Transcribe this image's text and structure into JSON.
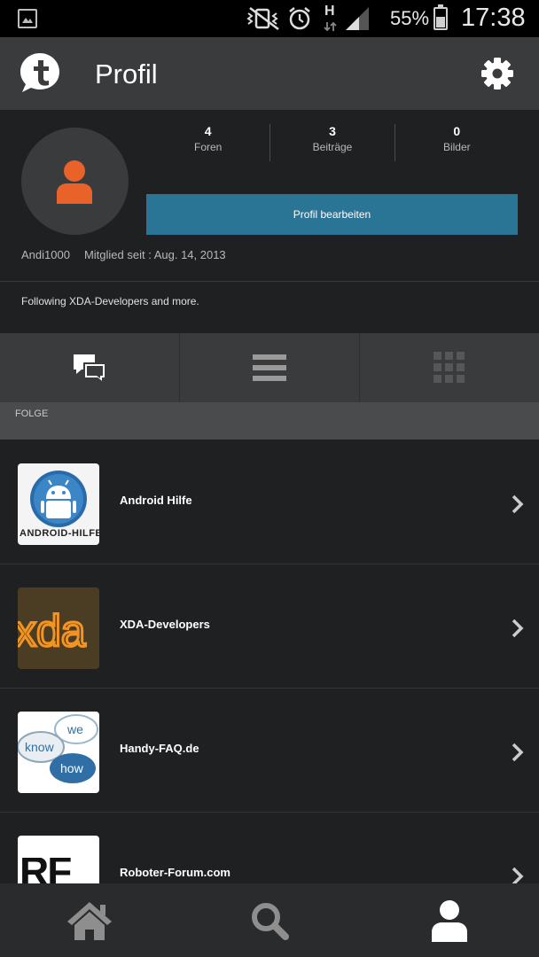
{
  "status_bar": {
    "battery_percent": "55%",
    "time": "17:38",
    "network_label": "H",
    "icons": [
      "gallery-icon",
      "vibrate-mute-icon",
      "alarm-icon",
      "network-h-icon",
      "signal-icon",
      "battery-icon"
    ]
  },
  "app_bar": {
    "title": "Profil",
    "logo_icon": "tapatalk-logo-icon",
    "settings_icon": "gear-icon"
  },
  "profile": {
    "stats": [
      {
        "value": "4",
        "label": "Foren"
      },
      {
        "value": "3",
        "label": "Beiträge"
      },
      {
        "value": "0",
        "label": "Bilder"
      }
    ],
    "edit_button": "Profil bearbeiten",
    "username": "Andi1000",
    "member_since": "Mitglied seit : Aug. 14, 2013",
    "bio": "Following XDA-Developers and more."
  },
  "tabs": [
    "chat-bubbles-icon",
    "list-icon",
    "grid-icon"
  ],
  "section": {
    "label": "FOLGE"
  },
  "forums": [
    {
      "name": "Android Hilfe",
      "thumb_text": "ANDROID-HILFE"
    },
    {
      "name": "XDA-Developers",
      "thumb_text": "xda"
    },
    {
      "name": "Handy-FAQ.de",
      "thumb_words": [
        "we",
        "know",
        "how"
      ]
    },
    {
      "name": "Roboter-Forum.com",
      "thumb_text": "RF"
    }
  ],
  "bottom_nav": [
    "home-icon",
    "search-icon",
    "user-icon"
  ],
  "colors": {
    "accent_button": "#2a7595",
    "avatar_person": "#e8622a",
    "app_bar": "#3a3b3d",
    "background": "#1f2022"
  }
}
